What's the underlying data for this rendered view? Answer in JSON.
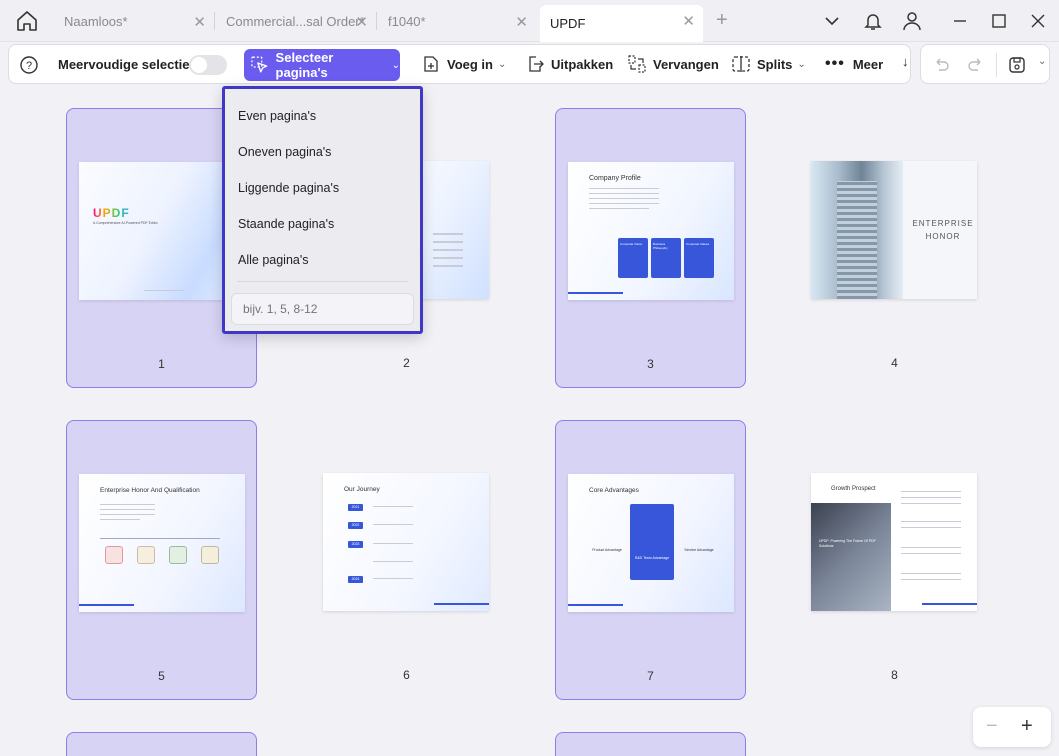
{
  "tabs": [
    {
      "label": "Naamloos*"
    },
    {
      "label": "Commercial...sal Order*"
    },
    {
      "label": "f1040*"
    },
    {
      "label": "UPDF"
    }
  ],
  "toolbar": {
    "multi_select_label": "Meervoudige selectie",
    "multi_select_on": false,
    "select_pages_label": "Selecteer pagina's",
    "insert_label": "Voeg in",
    "extract_label": "Uitpakken",
    "replace_label": "Vervangen",
    "split_label": "Splits",
    "more_label": "Meer"
  },
  "dropdown": {
    "items": [
      "Even pagina's",
      "Oneven pagina's",
      "Liggende pagina's",
      "Staande pagina's",
      "Alle pagina's"
    ],
    "range_placeholder": "bijv. 1, 5, 8-12"
  },
  "pages": [
    {
      "number": "1",
      "selected": true,
      "title": "UPDF",
      "subtitle": "A Comprehensive AI-Powered PDF Editor"
    },
    {
      "number": "2",
      "selected": false
    },
    {
      "number": "3",
      "selected": true,
      "title": "Company Profile",
      "cards": [
        "Corporate Vision",
        "Business Philosophy",
        "Corporate Values"
      ]
    },
    {
      "number": "4",
      "selected": false,
      "title": "ENTERPRISE HONOR"
    },
    {
      "number": "5",
      "selected": true,
      "title": "Enterprise Honor And Qualification"
    },
    {
      "number": "6",
      "selected": false,
      "title": "Our Journey",
      "years": [
        "2021",
        "2022",
        "2023",
        "2024"
      ]
    },
    {
      "number": "7",
      "selected": true,
      "title": "Core Advantages",
      "columns": [
        "Product Advantage",
        "R&D Team Advantage",
        "Service Advantage"
      ]
    },
    {
      "number": "8",
      "selected": false,
      "title": "Growth Prospect",
      "caption": "UPDF: Powering The Future Of PDF Solutions"
    }
  ],
  "colors": {
    "accent": "#6b5cf0",
    "selection_bg": "#d7d3f5",
    "dropdown_border": "#3f38c7"
  }
}
